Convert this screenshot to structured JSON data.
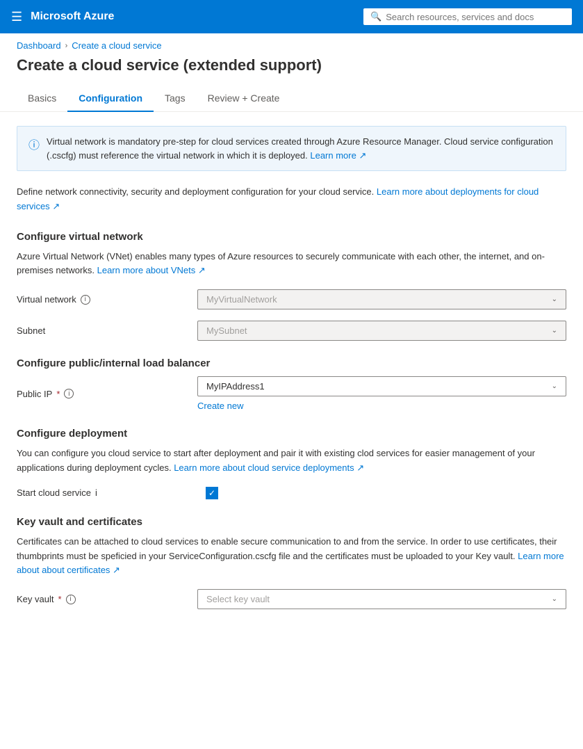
{
  "topnav": {
    "brand": "Microsoft Azure",
    "search_placeholder": "Search resources, services and docs"
  },
  "breadcrumb": {
    "items": [
      "Dashboard",
      "Create a cloud service"
    ]
  },
  "page_title": "Create a cloud service (extended support)",
  "tabs": [
    {
      "label": "Basics",
      "active": false
    },
    {
      "label": "Configuration",
      "active": true
    },
    {
      "label": "Tags",
      "active": false
    },
    {
      "label": "Review + Create",
      "active": false
    }
  ],
  "info_banner": {
    "text": "Virtual network is mandatory pre-step for cloud services created through Azure Resource Manager. Cloud service configuration (.cscfg) must reference the virtual network in which it is deployed.",
    "link_text": "Learn more",
    "link_icon": "↗"
  },
  "section_desc": {
    "text": "Define network connectivity, security and deployment configuration for your cloud service.",
    "link_text": "Learn more about deployments for cloud services",
    "link_icon": "↗"
  },
  "virtual_network_section": {
    "heading": "Configure virtual network",
    "body": "Azure Virtual Network (VNet) enables many types of Azure resources to securely communicate with each other, the internet, and on-premises networks.",
    "link_text": "Learn more about VNets",
    "link_icon": "↗",
    "fields": [
      {
        "label": "Virtual network",
        "has_info": true,
        "required": false,
        "value": "MyVirtualNetwork",
        "disabled": true,
        "placeholder": "MyVirtualNetwork"
      },
      {
        "label": "Subnet",
        "has_info": false,
        "required": false,
        "value": "MySubnet",
        "disabled": true,
        "placeholder": "MySubnet"
      }
    ]
  },
  "load_balancer_section": {
    "heading": "Configure public/internal load balancer",
    "fields": [
      {
        "label": "Public IP",
        "has_info": true,
        "required": true,
        "value": "MyIPAddress1",
        "disabled": false,
        "placeholder": "MyIPAddress1"
      }
    ],
    "create_new_label": "Create new"
  },
  "deployment_section": {
    "heading": "Configure deployment",
    "body": "You can configure you cloud service to start after deployment and pair it with existing clod services for easier management of your applications during deployment cycles.",
    "link_text": "Learn more about cloud service deployments",
    "link_icon": "↗",
    "checkbox": {
      "label": "Start cloud service",
      "has_info": true,
      "checked": true
    }
  },
  "key_vault_section": {
    "heading": "Key vault and certificates",
    "body": "Certificates can be attached to cloud services to enable secure communication to and from the service. In order to use certificates, their thumbprints must be speficied in your ServiceConfiguration.cscfg file and the certificates must be uploaded to your Key vault.",
    "link_text": "Learn more about about certificates",
    "link_icon": "↗",
    "fields": [
      {
        "label": "Key vault",
        "has_info": true,
        "required": true,
        "value": "",
        "disabled": false,
        "placeholder": "Select key vault"
      }
    ]
  }
}
